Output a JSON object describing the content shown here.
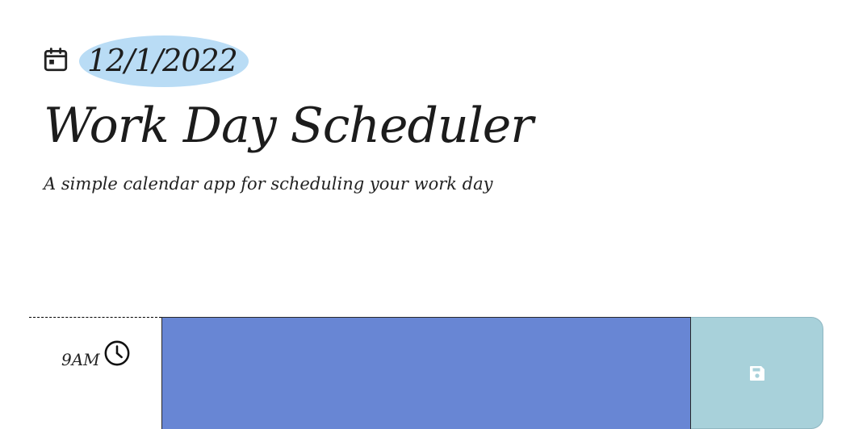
{
  "header": {
    "date": "12/1/2022",
    "title": "Work Day Scheduler",
    "subtitle": "A simple calendar app for scheduling your work day",
    "date_highlight_color": "#b9dcf5",
    "date_icon": "calendar-icon"
  },
  "time_blocks": [
    {
      "hour": "9AM",
      "hour_icon": "clock-icon",
      "description": "",
      "status": "future",
      "description_color": "#6886d4",
      "save_icon": "save-icon",
      "save_button_color": "#a8d1da"
    }
  ]
}
